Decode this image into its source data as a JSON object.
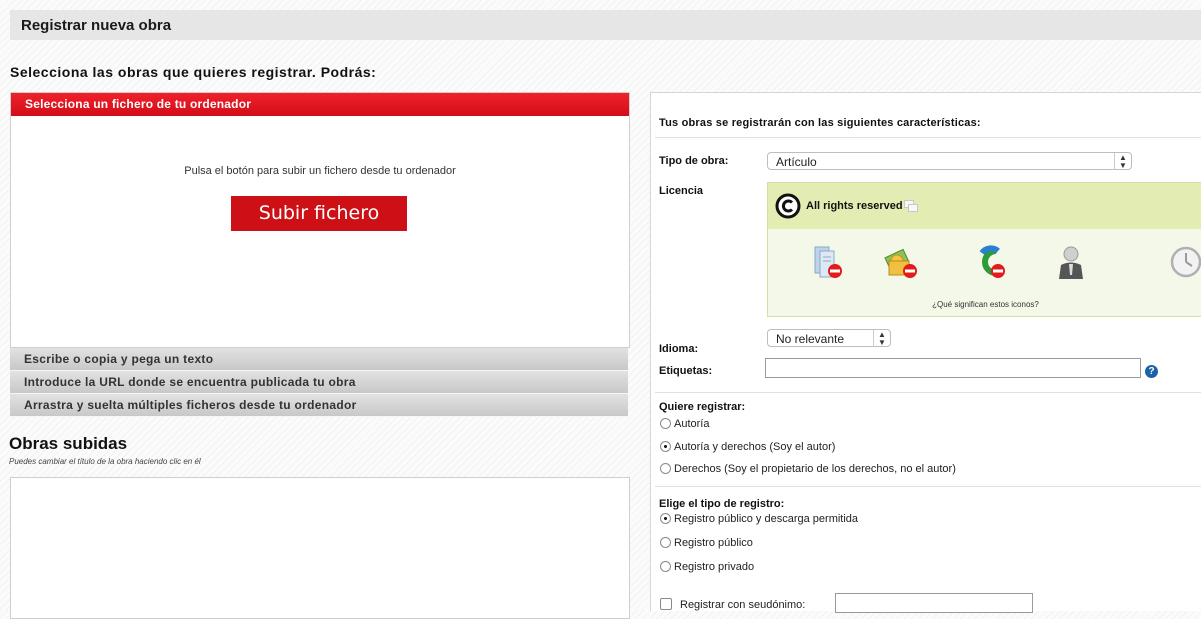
{
  "header": {
    "title": "Registrar nueva obra"
  },
  "subtitle": "Selecciona las obras que quieres registrar. Podrás:",
  "upload": {
    "tab_label": "Selecciona un fichero de tu ordenador",
    "instruction": "Pulsa el botón para subir un fichero desde tu ordenador",
    "button_label": "Subir fichero"
  },
  "options": [
    {
      "label": "Escribe o copia y pega un texto"
    },
    {
      "label": "Introduce la URL donde se encuentra publicada tu obra"
    },
    {
      "label": "Arrastra y suelta múltiples ficheros desde tu ordenador"
    }
  ],
  "uploaded": {
    "title": "Obras subidas",
    "hint": "Puedes cambiar el título de la obra haciendo clic en él"
  },
  "settings": {
    "heading": "Tus obras se registrarán con las siguientes características:",
    "work_type": {
      "label": "Tipo de obra:",
      "value": "Artículo"
    },
    "license": {
      "label": "Licencia",
      "name": "All rights reserved",
      "icons": [
        "document-no-icon",
        "money-no-icon",
        "modify-no-icon",
        "person-icon",
        "clock-icon"
      ],
      "question": "¿Qué significan estos iconos?"
    },
    "language": {
      "label": "Idioma:",
      "value": "No relevante"
    },
    "tags": {
      "label": "Etiquetas:",
      "value": ""
    },
    "register": {
      "label": "Quiere registrar:",
      "options": [
        {
          "label": "Autoría",
          "selected": false
        },
        {
          "label": "Autoría y derechos (Soy el autor)",
          "selected": true
        },
        {
          "label": "Derechos (Soy el propietario de los derechos, no el autor)",
          "selected": false
        }
      ]
    },
    "registry_type": {
      "label": "Elige el tipo de registro:",
      "options": [
        {
          "label": "Registro público y descarga permitida",
          "selected": true
        },
        {
          "label": "Registro público",
          "selected": false
        },
        {
          "label": "Registro privado",
          "selected": false
        }
      ]
    },
    "pseudonym": {
      "label": "Registrar con seudónimo:",
      "value": ""
    }
  },
  "colors": {
    "accent": "#cc1016",
    "tab_red": "#e8141e",
    "license_bg": "#e3ecb3",
    "help_blue": "#1b62a8"
  }
}
